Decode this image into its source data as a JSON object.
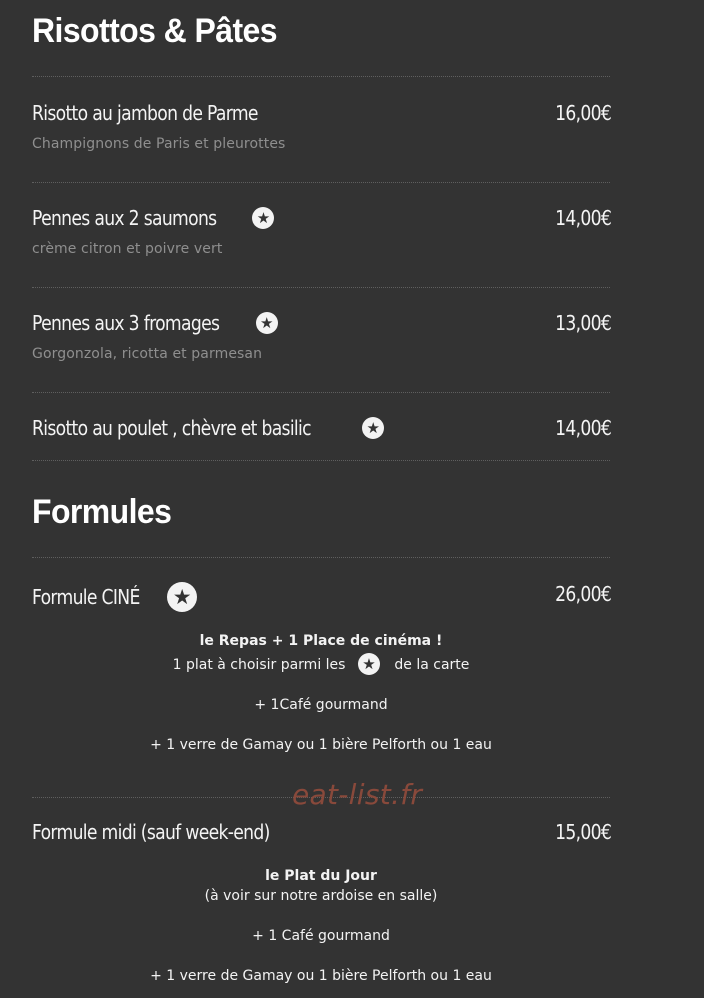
{
  "menu": {
    "sections": [
      {
        "title": "Risottos & Pâtes",
        "items": [
          {
            "name": "Risotto au jambon de Parme",
            "price": "16,00€",
            "description": "Champignons de Paris et pleurottes"
          },
          {
            "name": "Pennes aux 2 saumons",
            "price": "14,00€",
            "description": "crème citron et poivre vert",
            "icon": "star-icon"
          },
          {
            "name": "Pennes aux 3 fromages",
            "price": "13,00€",
            "description": "Gorgonzola, ricotta et parmesan",
            "icon": "star-icon"
          },
          {
            "name": "Risotto au poulet , chèvre et basilic",
            "price": "14,00€",
            "icon": "star-icon"
          }
        ]
      },
      {
        "title": "Formules",
        "items": [
          {
            "name": "Formule CINÉ",
            "price": "26,00€",
            "icon": "star-icon",
            "details": {
              "headline": "le Repas + 1 Place de cinéma !",
              "line_1_prefix": "1 plat à choisir parmi les",
              "line_1_suffix": "de la carte",
              "line_2": "+ 1Café gourmand",
              "line_3": "+ 1 verre de Gamay ou 1 bière Pelforth ou 1 eau"
            }
          },
          {
            "name": "Formule midi (sauf week-end)",
            "price": "15,00€",
            "details": {
              "headline": "le Plat du Jour",
              "line_1": "(à voir sur notre ardoise en salle)",
              "line_2": "+ 1 Café gourmand",
              "line_3": "+ 1 verre de Gamay ou 1 bière Pelforth ou 1 eau"
            }
          }
        ]
      }
    ]
  },
  "watermark": {
    "text": "eat-list.fr",
    "color": "#8e4b3c"
  },
  "colors": {
    "background": "#333333",
    "text_primary": "#f4f4f4",
    "text_secondary": "#8f8f8f",
    "divider": "#5f5f5f"
  }
}
